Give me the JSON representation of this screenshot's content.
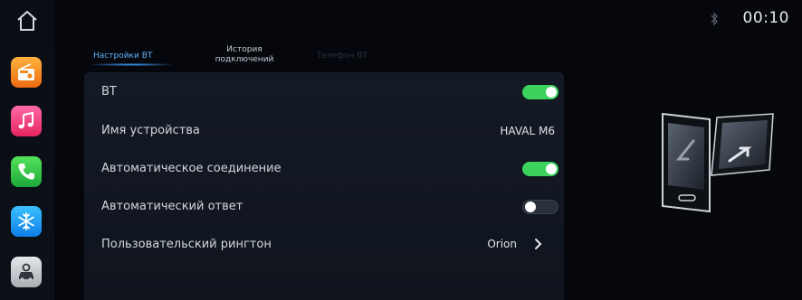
{
  "sidebar": {
    "home_icon": "home-icon",
    "apps": [
      {
        "name": "radio",
        "icon": "radio-icon",
        "color": "#f58a1f"
      },
      {
        "name": "music",
        "icon": "music-note-icon",
        "color": "#ef3e78"
      },
      {
        "name": "phone",
        "icon": "phone-icon",
        "color": "#33c44a"
      },
      {
        "name": "climate",
        "icon": "snowflake-icon",
        "color": "#1e9bf5"
      },
      {
        "name": "vehicle",
        "icon": "car-settings-icon",
        "color": "#c4c7cb"
      }
    ]
  },
  "status": {
    "bluetooth_icon": "bluetooth-icon",
    "time": "00:10"
  },
  "tabs": [
    {
      "label": "Настройки BT",
      "active": true
    },
    {
      "label": "История подключений",
      "line1": "История",
      "line2": "подключений",
      "active": false
    },
    {
      "label": "Телефон BT",
      "active": false,
      "disabled": true
    }
  ],
  "settings": {
    "bt": {
      "label": "BT",
      "toggle": "on"
    },
    "device_name": {
      "label": "Имя устройства",
      "value": "HAVAL M6"
    },
    "auto_connect": {
      "label": "Автоматическое соединение",
      "toggle": "on"
    },
    "auto_answer": {
      "label": "Автоматический ответ",
      "toggle": "off"
    },
    "ringtone": {
      "label": "Пользовательский рингтон",
      "value": "Orion"
    }
  },
  "colors": {
    "accent": "#3ea0ff",
    "toggle_on": "#3bd35e",
    "background": "#05070c",
    "panel": "#141a25"
  },
  "illustration": "phone-transfer-illustration"
}
